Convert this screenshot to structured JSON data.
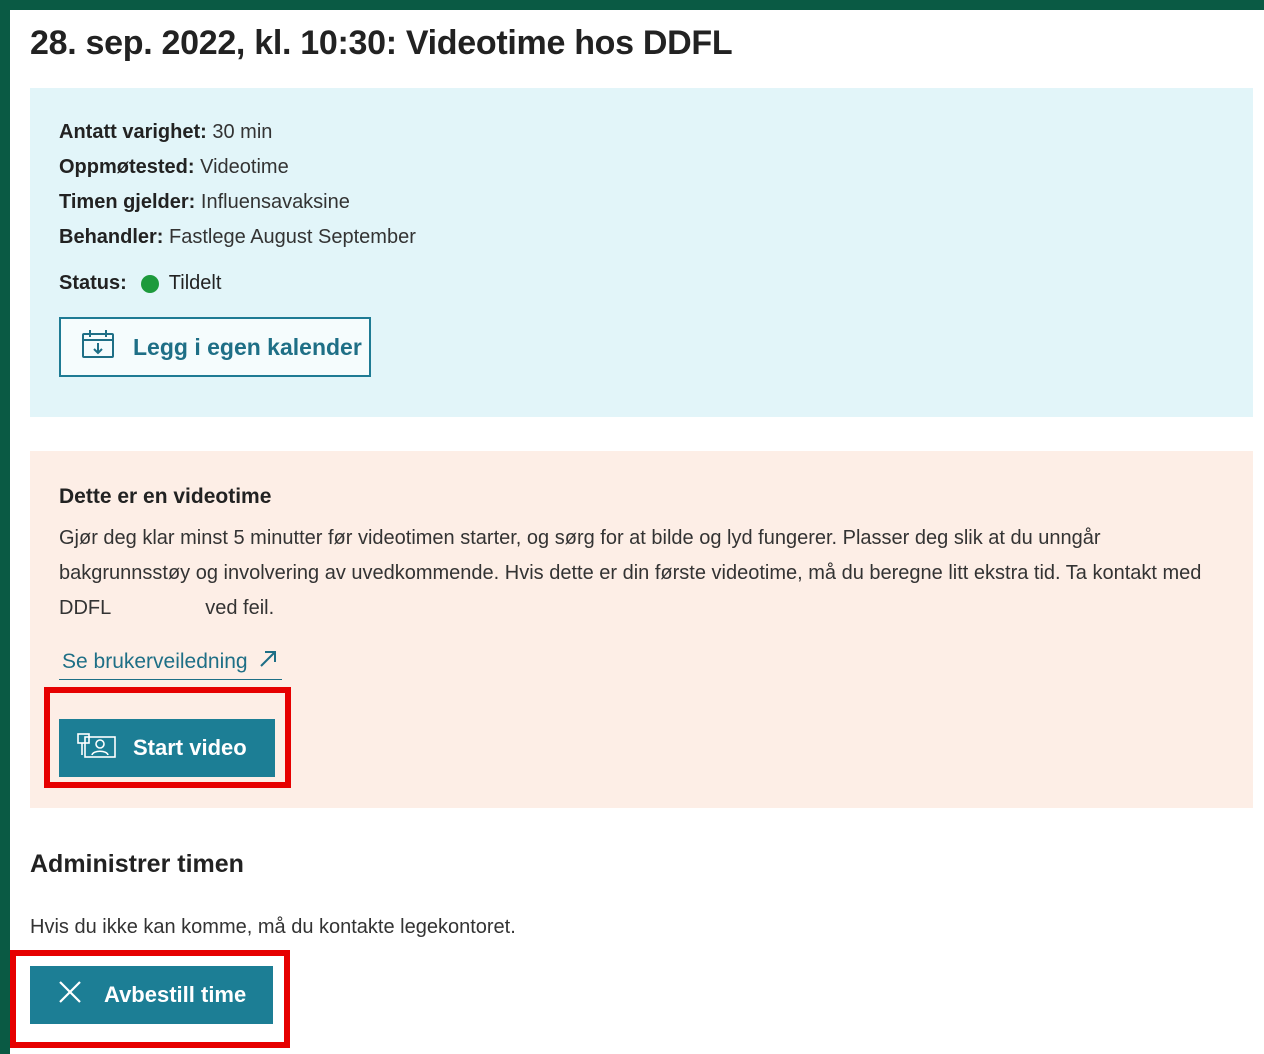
{
  "header": {
    "title": "28. sep. 2022, kl. 10:30: Videotime hos DDFL"
  },
  "details": {
    "duration_label": "Antatt varighet:",
    "duration_value": "30 min",
    "location_label": "Oppmøtested:",
    "location_value": "Videotime",
    "regarding_label": "Timen gjelder:",
    "regarding_value": "Influensavaksine",
    "practitioner_label": "Behandler:",
    "practitioner_value": "Fastlege August September",
    "status_label": "Status:",
    "status_value": "Tildelt",
    "status_color": "#1d9a3c",
    "calendar_button": "Legg i egen kalender",
    "calendar_icon": "calendar-download-icon"
  },
  "video": {
    "heading": "Dette er en videotime",
    "text_main": "Gjør deg klar minst 5 minutter før videotimen starter, og sørg for at bilde og lyd fungerer. Plasser deg slik at du unngår bakgrunnsstøy og involvering av uvedkommende. Hvis dette er din første videotime, må du beregne litt ekstra tid. Ta kontakt med DDFL",
    "text_end": "ved feil.",
    "guide_link": "Se brukerveiledning",
    "start_button": "Start video",
    "start_icon": "video-call-icon"
  },
  "admin": {
    "heading": "Administrer timen",
    "text": "Hvis du ikke kan komme, må du kontakte legekontoret.",
    "cancel_button": "Avbestill time"
  },
  "colors": {
    "primary": "#1c7e95",
    "info_bg": "#e2f5f9",
    "video_bg": "#fdeee6",
    "highlight": "#e60000",
    "frame": "#0a5a44"
  }
}
